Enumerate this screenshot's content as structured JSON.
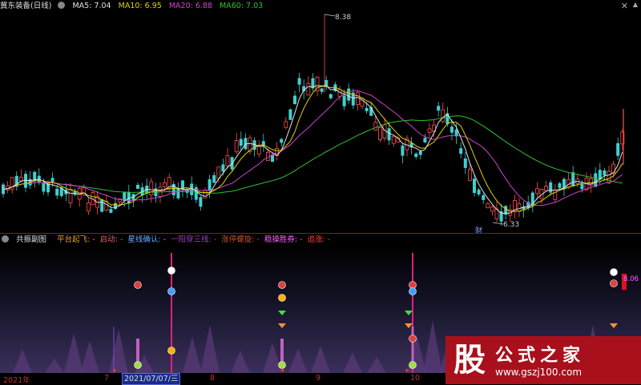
{
  "main_legend": {
    "stock": "冀东装备(日线)",
    "ma5_label": "MA5: 7.04",
    "ma10_label": "MA10: 6.95",
    "ma20_label": "MA20: 6.88",
    "ma60_label": "MA60: 7.03"
  },
  "price_labels": {
    "high": "8.38",
    "low": "6.33",
    "cai": "财"
  },
  "sub_legend": {
    "name": "共振副图",
    "items": [
      {
        "text": "平台起飞: -",
        "color": "#e0a040"
      },
      {
        "text": "启动: -",
        "color": "#e06060"
      },
      {
        "text": "星线确认: -",
        "color": "#6fa8ff"
      },
      {
        "text": "一阳穿三线: -",
        "color": "#a040c0"
      },
      {
        "text": "涨停螺旋: -",
        "color": "#c05030"
      },
      {
        "text": "稳操胜券: -",
        "color": "#ff60ff"
      },
      {
        "text": "追涨: -",
        "color": "#ff4040"
      }
    ],
    "right_value": "8.06"
  },
  "timebar": {
    "year": "2021年",
    "m7": "7",
    "date": "2021/07/07/三",
    "m8": "8",
    "m9": "9",
    "m10": "10"
  },
  "logo": {
    "char": "股",
    "title": "公式之家",
    "url": "www.gszj100.com"
  },
  "colors": {
    "ma5": "#e0e0e0",
    "ma10": "#e0d000",
    "ma20": "#d040d0",
    "ma60": "#30c030",
    "up": "#ff5050",
    "down": "#40d0d0"
  }
}
